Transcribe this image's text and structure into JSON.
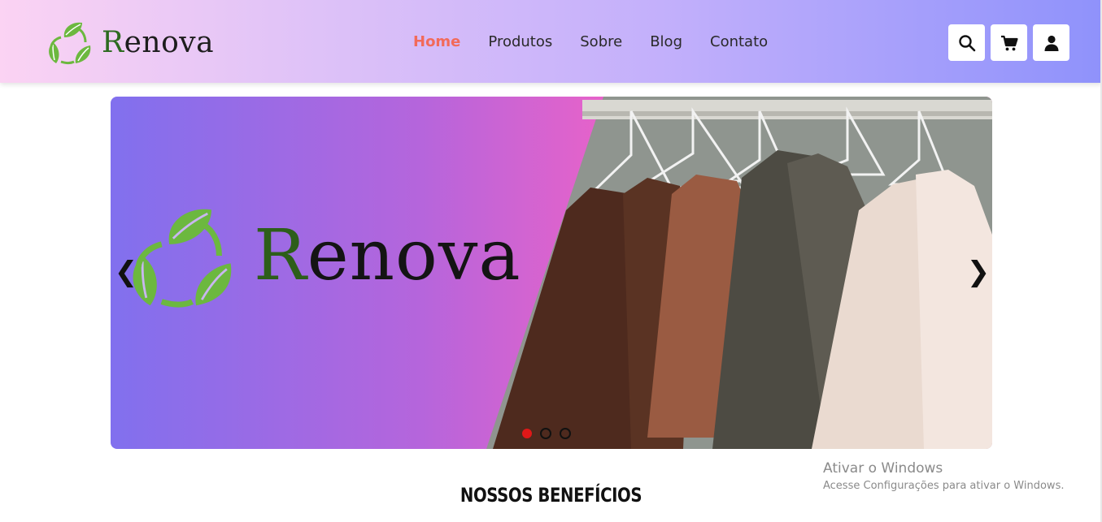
{
  "brand": {
    "name_first": "R",
    "name_rest": "enova"
  },
  "nav": {
    "items": [
      {
        "label": "Home",
        "active": true
      },
      {
        "label": "Produtos",
        "active": false
      },
      {
        "label": "Sobre",
        "active": false
      },
      {
        "label": "Blog",
        "active": false
      },
      {
        "label": "Contato",
        "active": false
      }
    ]
  },
  "header_icons": [
    "search-icon",
    "cart-icon",
    "user-icon"
  ],
  "carousel": {
    "slide_logo_first": "R",
    "slide_logo_rest": "enova",
    "prev_arrow": "❮",
    "next_arrow": "❯",
    "slide_count": 3,
    "active_slide": 1
  },
  "benefits": {
    "title": "NOSSOS BENEFÍCIOS"
  },
  "windows_watermark": {
    "title": "Ativar o Windows",
    "subtitle": "Acesse Configurações para ativar o Windows."
  },
  "colors": {
    "active_nav": "#f26a5a",
    "leaf_green": "#6cb83f",
    "active_dot": "#e01818"
  }
}
